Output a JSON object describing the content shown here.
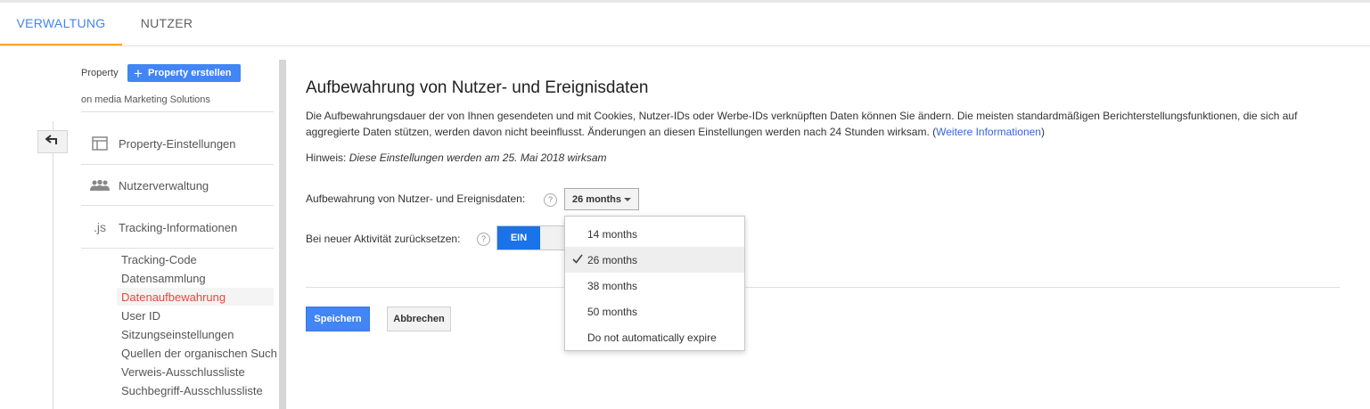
{
  "tabs": {
    "admin": "VERWALTUNG",
    "users": "NUTZER"
  },
  "sidebar": {
    "property_label": "Property",
    "create_property_plus": "+",
    "create_property_label": "Property erstellen",
    "account_name": "on media Marketing Solutions",
    "items": [
      {
        "label": "Property-Einstellungen",
        "icon": "layout-icon"
      },
      {
        "label": "Nutzerverwaltung",
        "icon": "people-icon"
      },
      {
        "label": "Tracking-Informationen",
        "icon": "js-icon",
        "icon_text": ".js"
      }
    ],
    "subitems": [
      "Tracking-Code",
      "Datensammlung",
      "Datenaufbewahrung",
      "User ID",
      "Sitzungseinstellungen",
      "Quellen der organischen Such",
      "Verweis-Ausschlussliste",
      "Suchbegriff-Ausschlussliste"
    ],
    "active_subitem": "Datenaufbewahrung"
  },
  "main": {
    "title": "Aufbewahrung von Nutzer- und Ereignisdaten",
    "description": "Die Aufbewahrungsdauer der von Ihnen gesendeten und mit Cookies, Nutzer-IDs oder Werbe-IDs verknüpften Daten können Sie ändern. Die meisten standardmäßigen Berichterstellungsfunktionen, die sich auf aggregierte Daten stützen, werden davon nicht beeinflusst. Änderungen an diesen Einstellungen werden nach 24 Stunden wirksam. (",
    "description_link": "Weitere Informationen",
    "description_end": ")",
    "note_label": "Hinweis:",
    "note_text": "Diese Einstellungen werden am 25. Mai 2018 wirksam",
    "retention_label": "Aufbewahrung von Nutzer- und Ereignisdaten:",
    "retention_value": "26 months",
    "reset_label": "Bei neuer Aktivität zurücksetzen:",
    "toggle_on_label": "EIN",
    "help_glyph": "?",
    "save_label": "Speichern",
    "cancel_label": "Abbrechen"
  },
  "dropdown": {
    "options": [
      "14 months",
      "26 months",
      "38 months",
      "50 months",
      "Do not automatically expire"
    ],
    "selected": "26 months"
  },
  "colors": {
    "accent": "#4285f4",
    "tab_underline": "#f9a825",
    "active_nav": "#e34b3a",
    "toggle_on": "#1a73e8"
  }
}
